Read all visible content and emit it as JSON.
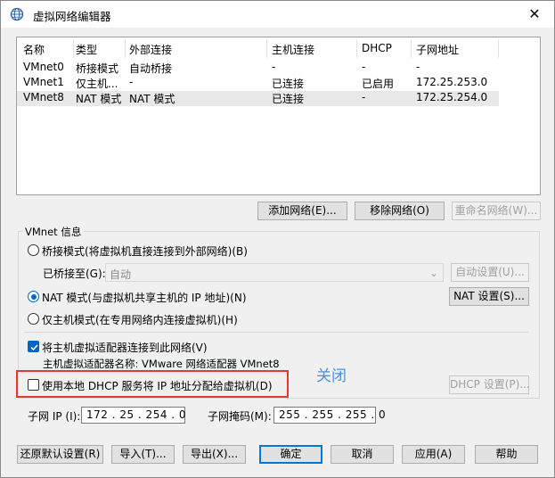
{
  "window": {
    "title": "虚拟网络编辑器",
    "close_glyph": "✕"
  },
  "list": {
    "headers": [
      "名称",
      "类型",
      "外部连接",
      "主机连接",
      "DHCP",
      "子网地址"
    ],
    "rows": [
      [
        "VMnet0",
        "桥接模式",
        "自动桥接",
        "-",
        "-",
        "-"
      ],
      [
        "VMnet1",
        "仅主机...",
        "-",
        "已连接",
        "已启用",
        "172.25.253.0"
      ],
      [
        "VMnet8",
        "NAT 模式",
        "NAT 模式",
        "已连接",
        "-",
        "172.25.254.0"
      ]
    ],
    "selected_row": 2
  },
  "list_buttons": {
    "add": "添加网络(E)...",
    "remove": "移除网络(O)",
    "rename": "重命名网络(W)..."
  },
  "vmnet_info": {
    "label": "VMnet 信息",
    "bridge_radio": "桥接模式(将虚拟机直接连接到外部网络)(B)",
    "bridged_to_label": "已桥接至(G):",
    "bridged_to_value": "自动",
    "auto_settings": "自动设置(U)...",
    "nat_radio": "NAT 模式(与虚拟机共享主机的 IP 地址)(N)",
    "nat_settings": "NAT 设置(S)...",
    "hostonly_radio": "仅主机模式(在专用网络内连接虚拟机)(H)",
    "connect_adapter": "将主机虚拟适配器连接到此网络(V)",
    "adapter_name": "主机虚拟适配器名称: VMware 网络适配器 VMnet8",
    "dhcp_check": "使用本地 DHCP 服务将 IP 地址分配给虚拟机(D)",
    "dhcp_settings": "DHCP 设置(P)...",
    "subnet_ip_label": "子网 IP (I):",
    "subnet_ip": "172 . 25 . 254 . 0",
    "subnet_mask_label": "子网掩码(M):",
    "subnet_mask": "255 . 255 . 255 . 0"
  },
  "annotation": "关闭",
  "footer": {
    "restore": "还原默认设置(R)",
    "import": "导入(T)...",
    "export": "导出(X)...",
    "ok": "确定",
    "cancel": "取消",
    "apply": "应用(A)",
    "help": "帮助"
  },
  "colors": {
    "accent": "#0067c0",
    "highlight_box": "#e53935",
    "annotation": "#4a90e2"
  }
}
